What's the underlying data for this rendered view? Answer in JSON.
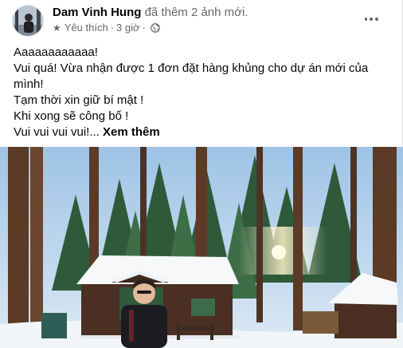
{
  "post": {
    "author": "Dam Vinh Hung",
    "action": "đã thêm 2 ảnh mới.",
    "favorite_label": "Yêu thích",
    "time": "3 giờ",
    "separator": "·",
    "privacy_icon": "globe-icon",
    "lines": [
      "Aaaaaaaaaaaa!",
      "Vui quá! Vừa nhận được 1 đơn đặt hàng khủng cho dự án mới của",
      "mình!",
      "Tạm thời xin giữ bí mật !",
      "Khi xong sẽ công bố !"
    ],
    "last_line": "Vui vui vui vui!...",
    "see_more": "Xem thêm"
  },
  "colors": {
    "text": "#050505",
    "secondary": "#65676b",
    "border": "#dadde1"
  }
}
